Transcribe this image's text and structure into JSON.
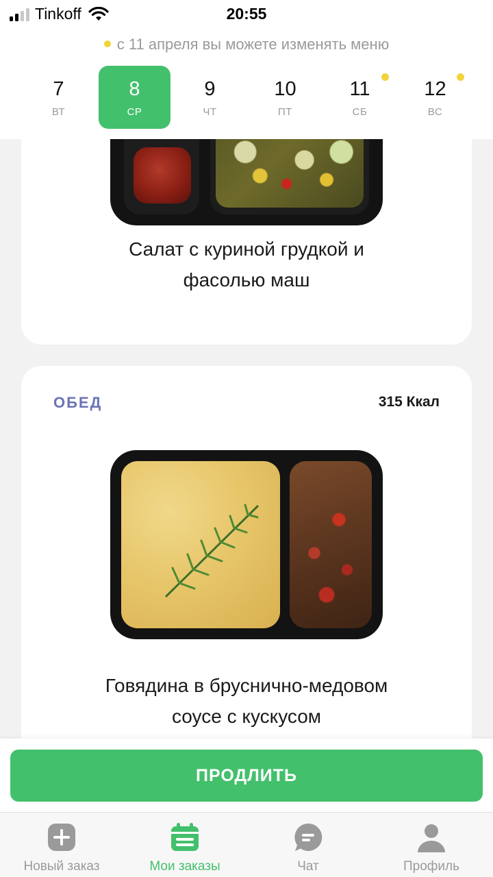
{
  "status_bar": {
    "carrier": "Tinkoff",
    "time": "20:55"
  },
  "notice": {
    "text": "с 11 апреля вы можете изменять меню",
    "dot_color": "#f3d33a"
  },
  "days": [
    {
      "num": "7",
      "dow": "ВТ",
      "active": false,
      "dot": false
    },
    {
      "num": "8",
      "dow": "СР",
      "active": true,
      "dot": false
    },
    {
      "num": "9",
      "dow": "ЧТ",
      "active": false,
      "dot": false
    },
    {
      "num": "10",
      "dow": "ПТ",
      "active": false,
      "dot": false
    },
    {
      "num": "11",
      "dow": "СБ",
      "active": false,
      "dot": true
    },
    {
      "num": "12",
      "dow": "ВС",
      "active": false,
      "dot": true
    }
  ],
  "meals": [
    {
      "name_line1": "Салат с куриной грудкой и",
      "name_line2": "фасолью маш"
    },
    {
      "label": "ОБЕД",
      "kcal": "315 Ккал",
      "name_line1": "Говядина в бруснично-медовом",
      "name_line2": "соусе с кускусом"
    }
  ],
  "action": {
    "extend_label": "ПРОДЛИТЬ"
  },
  "tabs": [
    {
      "label": "Новый заказ",
      "icon": "plus-square-icon",
      "active": false
    },
    {
      "label": "Мои заказы",
      "icon": "calendar-icon",
      "active": true
    },
    {
      "label": "Чат",
      "icon": "chat-bubble-icon",
      "active": false
    },
    {
      "label": "Профиль",
      "icon": "user-icon",
      "active": false
    }
  ],
  "colors": {
    "accent": "#43c06c",
    "meal_label": "#6a74b4",
    "indicator": "#f3d33a"
  }
}
